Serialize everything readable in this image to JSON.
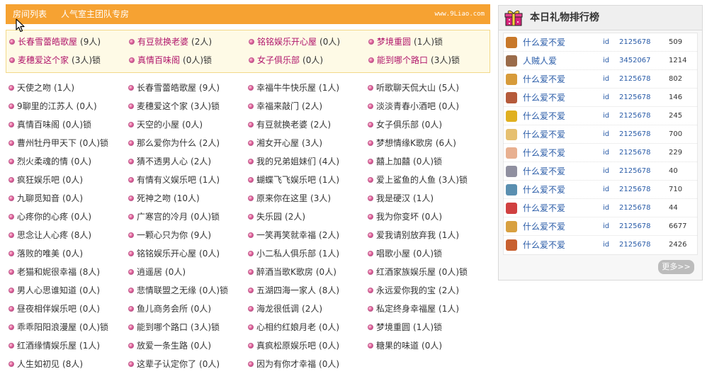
{
  "header": {
    "tabs": [
      "房间列表",
      "人气室主团队专房"
    ],
    "site": "www.9Liao.com"
  },
  "featured_rooms": [
    {
      "name": "长春雪蕾皓歌屋",
      "count": "(9人)",
      "lock": ""
    },
    {
      "name": "有豆就换老婆",
      "count": "(2人)",
      "lock": ""
    },
    {
      "name": "铭铭娱乐开心屋",
      "count": "(0人)",
      "lock": ""
    },
    {
      "name": "梦境重圆",
      "count": "(1人)",
      "lock": "锁"
    },
    {
      "name": "麦穗爱这个家",
      "count": "(3人)",
      "lock": "锁"
    },
    {
      "name": "真情百味阁",
      "count": "(0人)",
      "lock": "锁"
    },
    {
      "name": "女子俱乐部",
      "count": "(0人)",
      "lock": ""
    },
    {
      "name": "能到哪个路口",
      "count": "(3人)",
      "lock": "锁"
    }
  ],
  "rooms": [
    {
      "name": "天使之吻",
      "count": "(1人)",
      "lock": ""
    },
    {
      "name": "长春雪蕾皓歌屋",
      "count": "(9人)",
      "lock": ""
    },
    {
      "name": "幸福牛牛快乐屋",
      "count": "(1人)",
      "lock": ""
    },
    {
      "name": "听歌聊天侃大山",
      "count": "(5人)",
      "lock": ""
    },
    {
      "name": "9聊里的江苏人",
      "count": "(0人)",
      "lock": ""
    },
    {
      "name": "麦穗爱这个家",
      "count": "(3人)",
      "lock": "锁"
    },
    {
      "name": "幸福来敲门",
      "count": "(2人)",
      "lock": ""
    },
    {
      "name": "淡淡青春小酒吧",
      "count": "(0人)",
      "lock": ""
    },
    {
      "name": "真情百味阁",
      "count": "(0人)",
      "lock": "锁"
    },
    {
      "name": "天空的小屋",
      "count": "(0人)",
      "lock": ""
    },
    {
      "name": "有豆就换老婆",
      "count": "(2人)",
      "lock": ""
    },
    {
      "name": "女子俱乐部",
      "count": "(0人)",
      "lock": ""
    },
    {
      "name": "曹州牡丹甲天下",
      "count": "(0人)",
      "lock": "锁"
    },
    {
      "name": "那么爱你为什么",
      "count": "(2人)",
      "lock": ""
    },
    {
      "name": "湘女开心屋",
      "count": "(3人)",
      "lock": ""
    },
    {
      "name": "梦想情缘K歌房",
      "count": "(6人)",
      "lock": ""
    },
    {
      "name": "烈火柔魂的情",
      "count": "(0人)",
      "lock": ""
    },
    {
      "name": "猜不透男人心",
      "count": "(2人)",
      "lock": ""
    },
    {
      "name": "我的兄弟姐妹们",
      "count": "(4人)",
      "lock": ""
    },
    {
      "name": "囍上加囍",
      "count": "(0人)",
      "lock": "锁"
    },
    {
      "name": "疯狂娱乐吧",
      "count": "(0人)",
      "lock": ""
    },
    {
      "name": "有情有义娱乐吧",
      "count": "(1人)",
      "lock": ""
    },
    {
      "name": "蝴蝶飞飞娱乐吧",
      "count": "(1人)",
      "lock": ""
    },
    {
      "name": "爱上鲨鱼的人鱼",
      "count": "(3人)",
      "lock": "锁"
    },
    {
      "name": "九聊觅知音",
      "count": "(0人)",
      "lock": ""
    },
    {
      "name": "死神之吻",
      "count": "(10人)",
      "lock": ""
    },
    {
      "name": "原来你在这里",
      "count": "(3人)",
      "lock": ""
    },
    {
      "name": "我是硬汉",
      "count": "(1人)",
      "lock": ""
    },
    {
      "name": "心疼你的心疼",
      "count": "(0人)",
      "lock": ""
    },
    {
      "name": "广寒宫的冷月",
      "count": "(0人)",
      "lock": "锁"
    },
    {
      "name": "失乐园",
      "count": "(2人)",
      "lock": ""
    },
    {
      "name": "我为你变坏",
      "count": "(0人)",
      "lock": ""
    },
    {
      "name": "思念让人心疼",
      "count": "(8人)",
      "lock": ""
    },
    {
      "name": "一颗心只为你",
      "count": "(9人)",
      "lock": ""
    },
    {
      "name": "一笑再笑就幸福",
      "count": "(2人)",
      "lock": ""
    },
    {
      "name": "爱我请别放弃我",
      "count": "(1人)",
      "lock": ""
    },
    {
      "name": "落败的唯美",
      "count": "(0人)",
      "lock": ""
    },
    {
      "name": "铭铭娱乐开心屋",
      "count": "(0人)",
      "lock": ""
    },
    {
      "name": "小二私人俱乐部",
      "count": "(1人)",
      "lock": ""
    },
    {
      "name": "唱歌小屋",
      "count": "(0人)",
      "lock": "锁"
    },
    {
      "name": "老猫和妮很幸福",
      "count": "(8人)",
      "lock": ""
    },
    {
      "name": "逍遥居",
      "count": "(0人)",
      "lock": ""
    },
    {
      "name": "醉酒当歌K歌房",
      "count": "(0人)",
      "lock": ""
    },
    {
      "name": "红酒家族娱乐屋",
      "count": "(0人)",
      "lock": "锁"
    },
    {
      "name": "男人心思谁知道",
      "count": "(0人)",
      "lock": ""
    },
    {
      "name": "悲情联盟之无缘",
      "count": "(0人)",
      "lock": "锁"
    },
    {
      "name": "五湖四海一家人",
      "count": "(8人)",
      "lock": ""
    },
    {
      "name": "永远爱你我的宝",
      "count": "(2人)",
      "lock": ""
    },
    {
      "name": "昼夜相伴娱乐吧",
      "count": "(0人)",
      "lock": ""
    },
    {
      "name": "鱼儿商务会所",
      "count": "(0人)",
      "lock": ""
    },
    {
      "name": "海龙很低调",
      "count": "(2人)",
      "lock": ""
    },
    {
      "name": "私定终身幸福屋",
      "count": "(1人)",
      "lock": ""
    },
    {
      "name": "乖乖阳阳浪漫屋",
      "count": "(0人)",
      "lock": "锁"
    },
    {
      "name": "能到哪个路口",
      "count": "(3人)",
      "lock": "锁"
    },
    {
      "name": "心相约红娘月老",
      "count": "(0人)",
      "lock": ""
    },
    {
      "name": "梦境重圆",
      "count": "(1人)",
      "lock": "锁"
    },
    {
      "name": "红酒缘情娱乐屋",
      "count": "(1人)",
      "lock": ""
    },
    {
      "name": "放爱一条生路",
      "count": "(0人)",
      "lock": ""
    },
    {
      "name": "真疯松原娱乐吧",
      "count": "(0人)",
      "lock": ""
    },
    {
      "name": "糖果的味道",
      "count": "(0人)",
      "lock": ""
    },
    {
      "name": "人生如初见",
      "count": "(8人)",
      "lock": ""
    },
    {
      "name": "这辈子认定你了",
      "count": "(0人)",
      "lock": ""
    },
    {
      "name": "因为有你才幸福",
      "count": "(0人)",
      "lock": ""
    }
  ],
  "ranking": {
    "title": "本日礼物排行榜",
    "id_label": "id",
    "more": "更多>>",
    "items": [
      {
        "name": "什么爱不爱",
        "id": "2125678",
        "count": "509",
        "icon": "bear-gift-icon",
        "color": "#c8782a"
      },
      {
        "name": "人贼人爱",
        "id": "3452067",
        "count": "1214",
        "icon": "fridge-gift-icon",
        "color": "#9a6b4a"
      },
      {
        "name": "什么爱不爱",
        "id": "2125678",
        "count": "802",
        "icon": "jar-gift-icon",
        "color": "#d79b3a"
      },
      {
        "name": "什么爱不爱",
        "id": "2125678",
        "count": "146",
        "icon": "chopsticks-gift-icon",
        "color": "#b55a3a"
      },
      {
        "name": "什么爱不爱",
        "id": "2125678",
        "count": "245",
        "icon": "bag-gift-icon",
        "color": "#e0b020"
      },
      {
        "name": "什么爱不爱",
        "id": "2125678",
        "count": "700",
        "icon": "cake-gift-icon",
        "color": "#e6c070"
      },
      {
        "name": "什么爱不爱",
        "id": "2125678",
        "count": "229",
        "icon": "icecream-gift-icon",
        "color": "#e8b090"
      },
      {
        "name": "什么爱不爱",
        "id": "2125678",
        "count": "40",
        "icon": "ring-gift-icon",
        "color": "#9090a0"
      },
      {
        "name": "什么爱不爱",
        "id": "2125678",
        "count": "710",
        "icon": "map-gift-icon",
        "color": "#5a8fb0"
      },
      {
        "name": "什么爱不爱",
        "id": "2125678",
        "count": "44",
        "icon": "clown-gift-icon",
        "color": "#d04040"
      },
      {
        "name": "什么爱不爱",
        "id": "2125678",
        "count": "6677",
        "icon": "bandage-gift-icon",
        "color": "#d8a040"
      },
      {
        "name": "什么爱不爱",
        "id": "2125678",
        "count": "2426",
        "icon": "brick-gift-icon",
        "color": "#c86030"
      }
    ]
  }
}
